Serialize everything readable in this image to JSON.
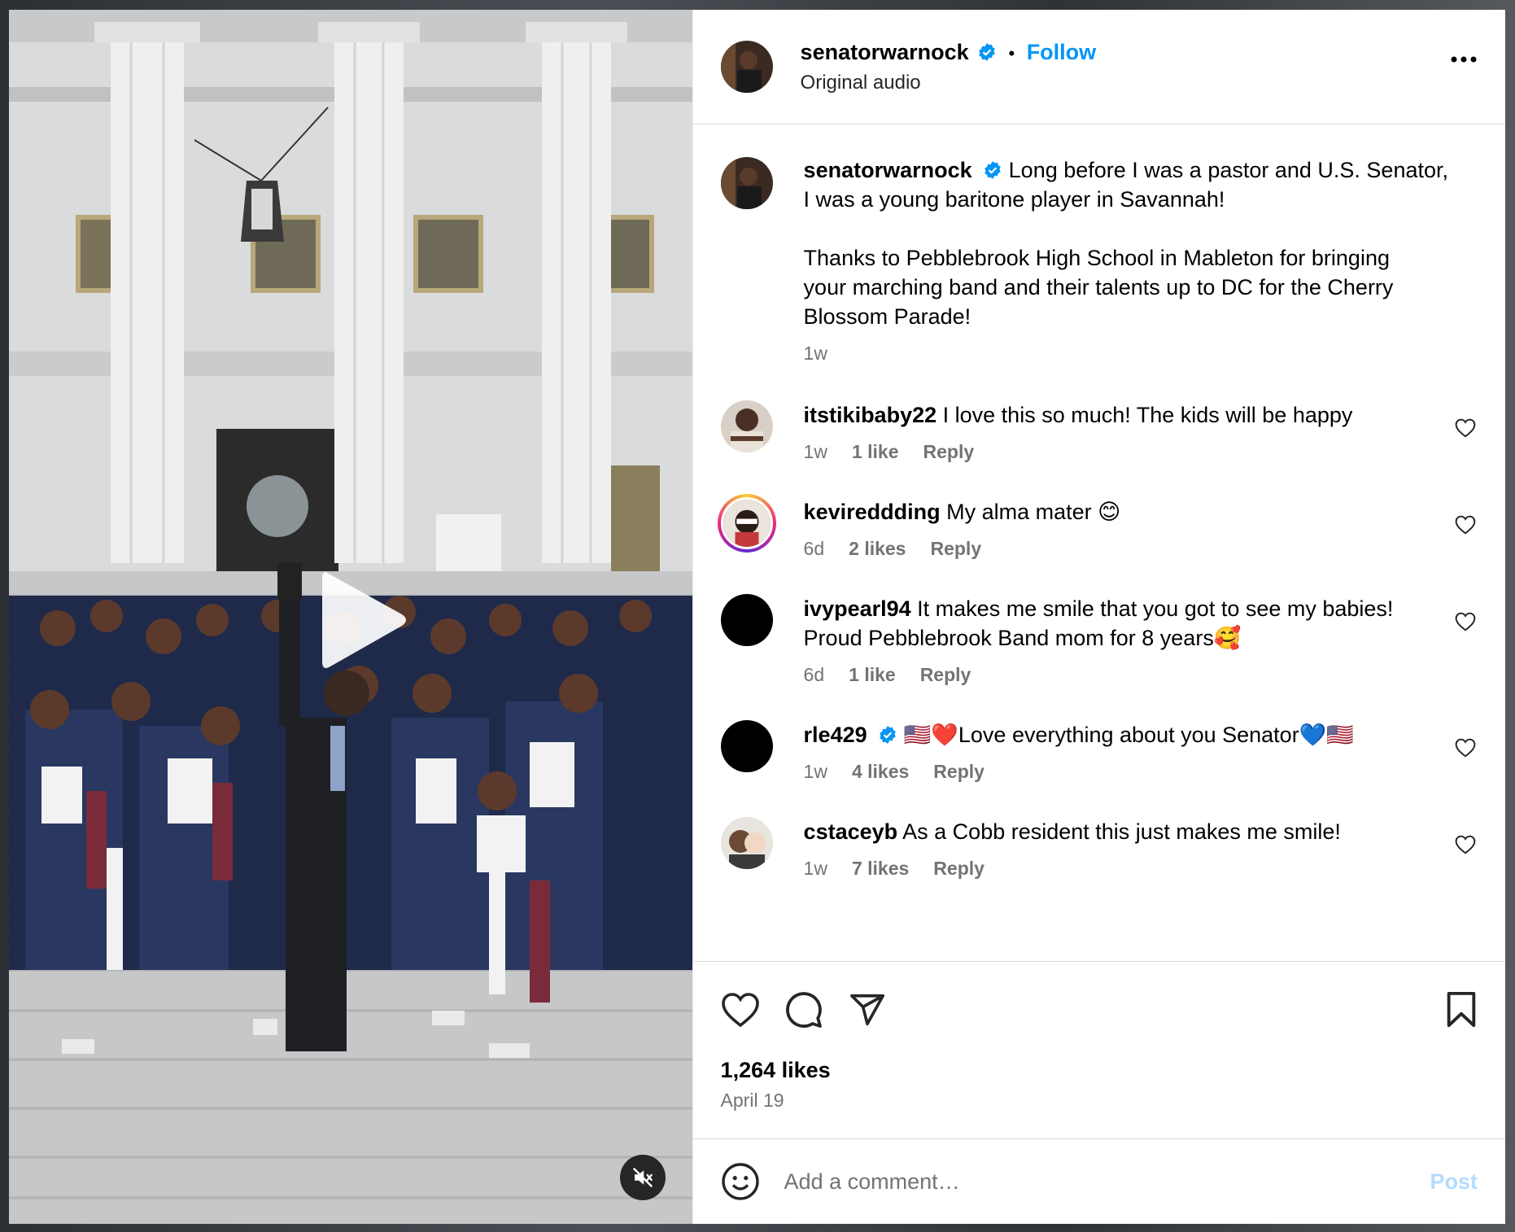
{
  "post": {
    "username": "senatorwarnock",
    "follow_label": "Follow",
    "separator": "•",
    "subtitle": "Original audio",
    "caption_line1": "Long before I was a pastor and U.S. Senator,",
    "caption_line2": "I was a young baritone player in Savannah!",
    "caption_line3": "Thanks to Pebblebrook High School in Mableton for bringing",
    "caption_line4": "your marching band and their talents up to DC for the Cherry",
    "caption_line5": "Blossom Parade!",
    "caption_time": "1w",
    "likes": "1,264 likes",
    "date": "April 19",
    "comment_placeholder": "Add a comment…",
    "post_label": "Post"
  },
  "comments": [
    {
      "user": "itstikibaby22",
      "line1": "I love this so much! The kids will be happy",
      "line2": "",
      "time": "1w",
      "likes": "1 like",
      "reply": "Reply",
      "avatar_color": "#6b4a3a"
    },
    {
      "user": "kevireddding",
      "line1": "My alma mater 😊",
      "line2": "",
      "time": "6d",
      "likes": "2 likes",
      "reply": "Reply",
      "avatar_color": "#2a2a2a"
    },
    {
      "user": "ivypearl94",
      "line1": "It makes me smile that you got to see my babies!",
      "line2": "Proud Pebblebrook Band mom for 8 years🥰",
      "time": "6d",
      "likes": "1 like",
      "reply": "Reply",
      "avatar_color": "#000000"
    },
    {
      "user": "rle429",
      "line1": "🇺🇸❤️Love everything about you Senator💙🇺🇸",
      "line2": "",
      "time": "1w",
      "likes": "4 likes",
      "reply": "Reply",
      "avatar_color": "#000000"
    },
    {
      "user": "cstaceyb",
      "line1": "As a Cobb resident this just makes me smile!",
      "line2": "",
      "time": "1w",
      "likes": "7 likes",
      "reply": "Reply",
      "avatar_color": "#8a7a6a"
    }
  ],
  "icons": {
    "play": "play-icon",
    "mute": "speaker-muted-icon",
    "verified": "verified-badge-icon",
    "more": "more-options-icon",
    "like": "heart-icon",
    "comment": "comment-bubble-icon",
    "share": "paper-plane-icon",
    "save": "bookmark-icon",
    "emoji": "smiley-icon"
  },
  "colors": {
    "accent": "#0095f6",
    "verified": "#0095f6",
    "muted_text": "#737373",
    "post_disabled": "#b3dbff"
  }
}
